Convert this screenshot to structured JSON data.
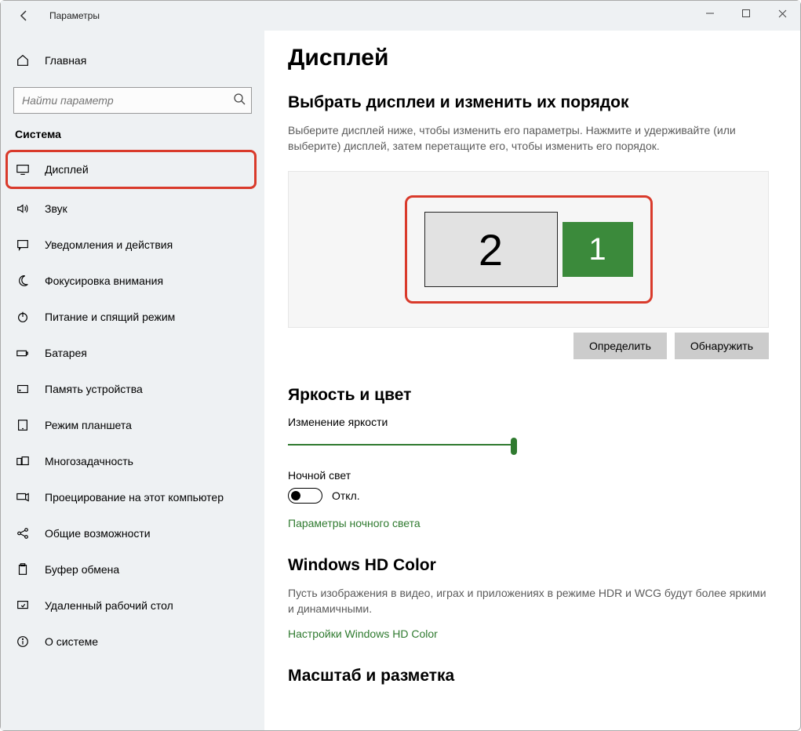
{
  "app": {
    "title": "Параметры"
  },
  "sidebar": {
    "home": "Главная",
    "search_placeholder": "Найти параметр",
    "section": "Система",
    "items": [
      {
        "icon": "monitor-icon",
        "label": "Дисплей",
        "active": true,
        "highlight": true
      },
      {
        "icon": "speaker-icon",
        "label": "Звук"
      },
      {
        "icon": "chat-icon",
        "label": "Уведомления и действия"
      },
      {
        "icon": "moon-icon",
        "label": "Фокусировка внимания"
      },
      {
        "icon": "power-icon",
        "label": "Питание и спящий режим"
      },
      {
        "icon": "battery-icon",
        "label": "Батарея"
      },
      {
        "icon": "storage-icon",
        "label": "Память устройства"
      },
      {
        "icon": "tablet-icon",
        "label": "Режим планшета"
      },
      {
        "icon": "multitask-icon",
        "label": "Многозадачность"
      },
      {
        "icon": "project-icon",
        "label": "Проецирование на этот компьютер"
      },
      {
        "icon": "share-icon",
        "label": "Общие возможности"
      },
      {
        "icon": "clipboard-icon",
        "label": "Буфер обмена"
      },
      {
        "icon": "remote-icon",
        "label": "Удаленный рабочий стол"
      },
      {
        "icon": "info-icon",
        "label": "О системе"
      }
    ]
  },
  "main": {
    "title": "Дисплей",
    "arrange": {
      "heading": "Выбрать дисплеи и изменить их порядок",
      "desc": "Выберите дисплей ниже, чтобы изменить его параметры. Нажмите и удерживайте (или выберите) дисплей, затем перетащите его, чтобы изменить его порядок.",
      "monitors": {
        "m2": "2",
        "m1": "1",
        "selected": 1
      },
      "identify": "Определить",
      "detect": "Обнаружить"
    },
    "brightness": {
      "heading": "Яркость и цвет",
      "slider_label": "Изменение яркости",
      "night_label": "Ночной свет",
      "night_state": "Откл.",
      "night_link": "Параметры ночного света"
    },
    "hdcolor": {
      "heading": "Windows HD Color",
      "desc": "Пусть изображения в видео, играх и приложениях в режиме HDR и WCG будут более яркими и динамичными.",
      "link": "Настройки Windows HD Color"
    },
    "scale": {
      "heading": "Масштаб и разметка"
    }
  }
}
